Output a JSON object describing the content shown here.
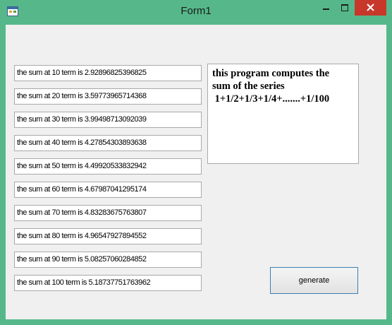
{
  "window": {
    "title": "Form1",
    "controls": [
      "minimize-icon",
      "maximize-icon",
      "close-icon"
    ],
    "frame_color": "#56b88a",
    "close_color": "#c7382b"
  },
  "outputs": [
    "the sum at 10 term is 2.92896825396825",
    "the sum at 20 term is 3.59773965714368",
    "the sum at 30 term is 3.99498713092039",
    "the sum at 40 term is 4.27854303893638",
    "the sum at 50 term is 4.49920533832942",
    "the sum at 60 term is 4.67987041295174",
    "the sum at 70 term is 4.83283675763807",
    "the sum at 80 term is 4.96547927894552",
    "the sum at 90 term is 5.08257060284852",
    "the sum at 100 term is 5.18737751763962"
  ],
  "description": {
    "line1": "this program computes the",
    "line2": "sum of the series",
    "line3": " 1+1/2+1/3+1/4+.......+1/100"
  },
  "generate_button": {
    "label": "generate"
  }
}
